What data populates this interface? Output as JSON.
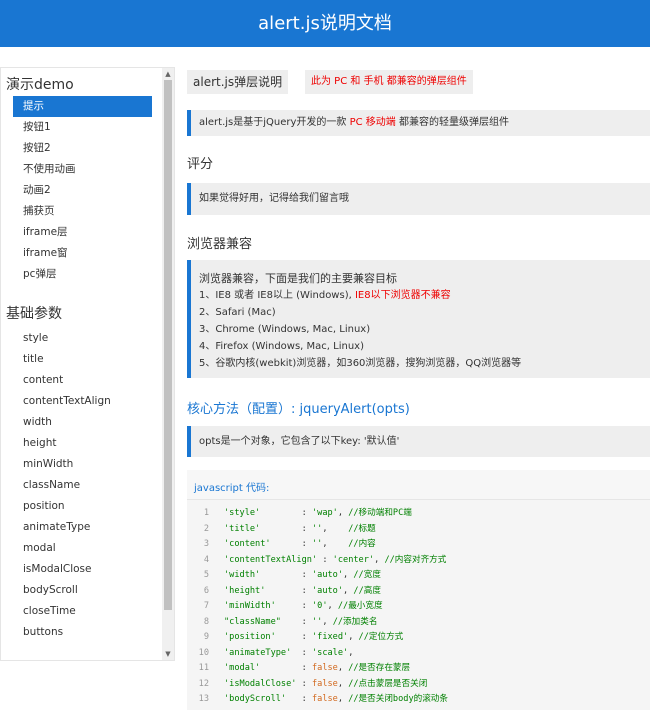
{
  "header": {
    "title": "alert.js说明文档"
  },
  "sidebar": {
    "section1_title": "演示demo",
    "demo_items": [
      "提示",
      "按钮1",
      "按钮2",
      "不使用动画",
      "动画2",
      "捕获页",
      "iframe层",
      "iframe窗",
      "pc弹层"
    ],
    "active_index": 0,
    "section2_title": "基础参数",
    "param_items": [
      "style",
      "title",
      "content",
      "contentTextAlign",
      "width",
      "height",
      "minWidth",
      "className",
      "position",
      "animateType",
      "modal",
      "isModalClose",
      "bodyScroll",
      "closeTime",
      "buttons"
    ]
  },
  "main": {
    "title": "alert.js弹层说明",
    "title_note": "此为 PC 和 手机 都兼容的弹层组件",
    "intro_prefix": "alert.js是基于jQuery开发的一款 ",
    "intro_highlight": "PC 移动端",
    "intro_suffix": " 都兼容的轻量级弹层组件",
    "score_heading": "评分",
    "score_text": "如果觉得好用，记得给我们留言哦",
    "compat_heading": "浏览器兼容",
    "compat_intro": "浏览器兼容，下面是我们的主要兼容目标",
    "compat_line1_prefix": "1、IE8 或者 IE8以上 (Windows), ",
    "compat_line1_warn": "IE8以下浏览器不兼容",
    "compat_line2": "2、Safari (Mac)",
    "compat_line3": "3、Chrome (Windows, Mac, Linux)",
    "compat_line4": "4、Firefox (Windows, Mac, Linux)",
    "compat_line5": "5、谷歌内核(webkit)浏览器，如360浏览器，搜狗浏览器，QQ浏览器等",
    "core_heading": "核心方法（配置）: jqueryAlert(opts)",
    "core_text": "opts是一个对象，它包含了以下key: '默认值'",
    "code_label": "javascript 代码:",
    "code_lines": [
      {
        "num": "1",
        "key": "'style'",
        "pad": "        : ",
        "val": "'wap'",
        "rest": ", ",
        "cmt": "//移动端和PC端"
      },
      {
        "num": "2",
        "key": "'title'",
        "pad": "        : ",
        "val": "''",
        "rest": ",    ",
        "cmt": "//标题"
      },
      {
        "num": "3",
        "key": "'content'",
        "pad": "      : ",
        "val": "''",
        "rest": ",    ",
        "cmt": "//内容"
      },
      {
        "num": "4",
        "key": "'contentTextAlign'",
        "pad": " : ",
        "val": "'center'",
        "rest": ", ",
        "cmt": "//内容对齐方式"
      },
      {
        "num": "5",
        "key": "'width'",
        "pad": "        : ",
        "val": "'auto'",
        "rest": ", ",
        "cmt": "//宽度"
      },
      {
        "num": "6",
        "key": "'height'",
        "pad": "       : ",
        "val": "'auto'",
        "rest": ", ",
        "cmt": "//高度"
      },
      {
        "num": "7",
        "key": "'minWidth'",
        "pad": "     : ",
        "val": "'0'",
        "rest": ", ",
        "cmt": "//最小宽度"
      },
      {
        "num": "8",
        "key": "\"className\"",
        "pad": "    : ",
        "val": "''",
        "rest": ", ",
        "cmt": "//添加类名"
      },
      {
        "num": "9",
        "key": "'position'",
        "pad": "     : ",
        "val": "'fixed'",
        "rest": ", ",
        "cmt": "//定位方式"
      },
      {
        "num": "10",
        "key": "'animateType'",
        "pad": "  : ",
        "val": "'scale'",
        "rest": ",",
        "cmt": ""
      },
      {
        "num": "11",
        "key": "'modal'",
        "pad": "        : ",
        "kw": "false",
        "rest": ", ",
        "cmt": "//是否存在蒙层"
      },
      {
        "num": "12",
        "key": "'isModalClose'",
        "pad": " : ",
        "kw": "false",
        "rest": ", ",
        "cmt": "//点击蒙层是否关闭"
      },
      {
        "num": "13",
        "key": "'bodyScroll'",
        "pad": "   : ",
        "kw": "false",
        "rest": ", ",
        "cmt": "//是否关闭body的滚动条"
      }
    ]
  },
  "colors": {
    "primary": "#1976d2",
    "warn": "#e00000",
    "code_string": "#008000",
    "code_keyword": "#d2691e"
  }
}
